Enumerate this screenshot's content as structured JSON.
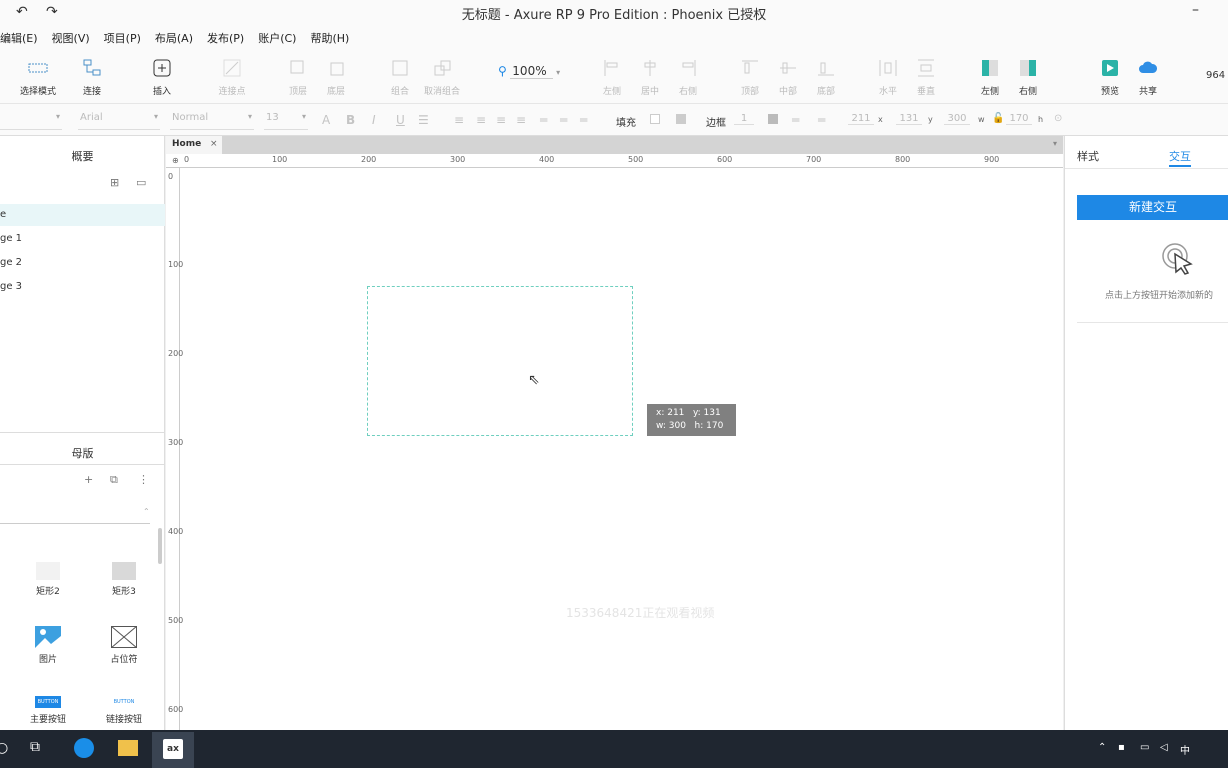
{
  "window": {
    "title": "无标题 - Axure RP 9 Pro Edition : Phoenix 已授权"
  },
  "menu": [
    "编辑(E)",
    "视图(V)",
    "项目(P)",
    "布局(A)",
    "发布(P)",
    "账户(C)",
    "帮助(H)"
  ],
  "toolbar": {
    "select_mode": "选择模式",
    "connect": "连接",
    "insert": "插入",
    "point": "连接点",
    "top_layer": "顶层",
    "bottom_layer": "底层",
    "combine": "组合",
    "ungroup": "取消组合",
    "zoom": "100%",
    "align_left": "左侧",
    "align_center": "居中",
    "align_right": "右侧",
    "align_top": "顶部",
    "align_middle": "中部",
    "align_bottom": "底部",
    "dist_h": "水平",
    "dist_v": "垂直",
    "left": "左侧",
    "right": "右侧",
    "preview": "预览",
    "share": "共享",
    "user_num": "964"
  },
  "format": {
    "style": "Normal",
    "font": "Arial",
    "size": "13",
    "fill_label": "填充",
    "border_label": "边框",
    "border_value": "1",
    "x": "211",
    "y": "131",
    "w": "300",
    "h": "170",
    "x_unit": "x",
    "y_unit": "y",
    "w_unit": "w",
    "h_unit": "h"
  },
  "left_panel": {
    "pages_title": "概要",
    "pages": [
      "e",
      "ge 1",
      "ge 2",
      "ge 3"
    ],
    "masters_title": "母版",
    "widgets": [
      "矩形2",
      "矩形3",
      "图片",
      "占位符",
      "主要按钮",
      "链接按钮"
    ],
    "button_text": "BUTTON"
  },
  "canvas": {
    "tab": "Home",
    "ruler_h": [
      "0",
      "100",
      "200",
      "300",
      "400",
      "500",
      "600",
      "700",
      "800",
      "900"
    ],
    "ruler_v": [
      "0",
      "100",
      "200",
      "300",
      "400",
      "500",
      "600"
    ],
    "tooltip_line1": "x: 211   y: 131",
    "tooltip_line2": "w: 300   h: 170",
    "watermark": "1533648421正在观看视频"
  },
  "right_panel": {
    "tab_style": "样式",
    "tab_interaction": "交互",
    "new_interaction": "新建交互",
    "hint": "点击上方按钮开始添加新的"
  },
  "colors": {
    "accent": "#1e88e5",
    "teal": "#2bb3a7",
    "selection": "#6fcfbf"
  }
}
